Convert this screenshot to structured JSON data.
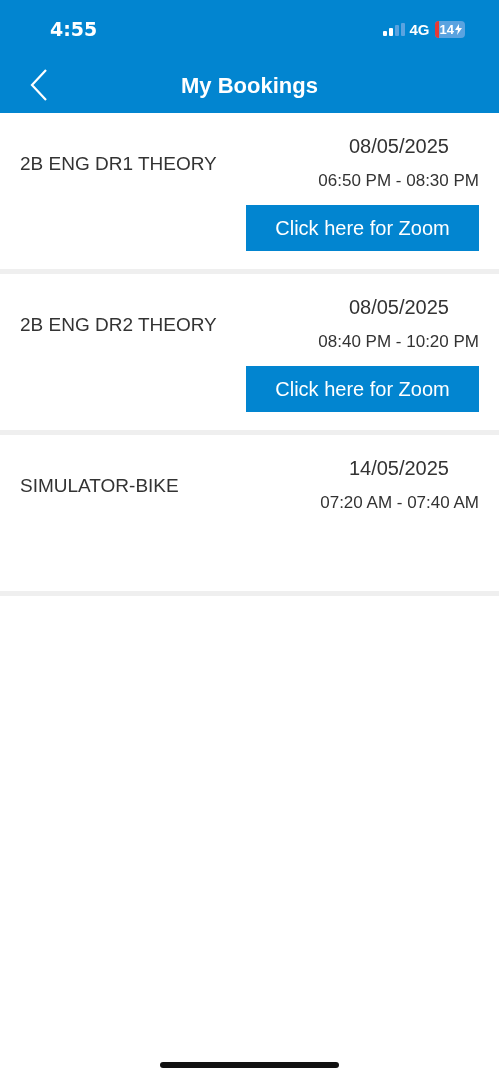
{
  "status_bar": {
    "time": "4:55",
    "network": "4G",
    "battery": "14"
  },
  "header": {
    "title": "My Bookings"
  },
  "bookings": [
    {
      "name": "2B ENG DR1 THEORY",
      "date": "08/05/2025",
      "time": "06:50 PM - 08:30 PM",
      "button": "Click here for Zoom"
    },
    {
      "name": "2B ENG DR2 THEORY",
      "date": "08/05/2025",
      "time": "08:40 PM - 10:20 PM",
      "button": "Click here for Zoom"
    },
    {
      "name": "SIMULATOR-BIKE",
      "date": "14/05/2025",
      "time": "07:20 AM - 07:40 AM"
    }
  ]
}
